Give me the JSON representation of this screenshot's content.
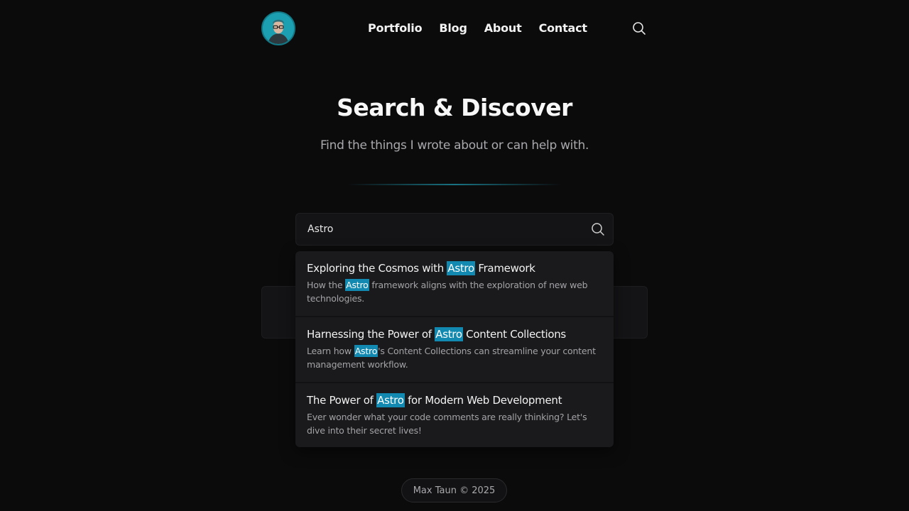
{
  "nav": {
    "avatar_icon": "avatar-portrait",
    "links": [
      "Portfolio",
      "Blog",
      "About",
      "Contact"
    ],
    "search_icon": "search-icon"
  },
  "hero": {
    "title": "Search & Discover",
    "subtitle": "Find the things I wrote about or can help with."
  },
  "search": {
    "value": "Astro",
    "placeholder": "",
    "icon": "search-icon"
  },
  "results": [
    {
      "title_before": "Exploring the Cosmos with ",
      "title_highlight": "Astro",
      "title_after": " Framework",
      "desc_before": "How the ",
      "desc_highlight": "Astro",
      "desc_after": " framework aligns with the exploration of new web technologies."
    },
    {
      "title_before": "Harnessing the Power of ",
      "title_highlight": "Astro",
      "title_after": " Content Collections",
      "desc_before": "Learn how ",
      "desc_highlight": "Astro",
      "desc_after": "'s Content Collections can streamline your content management workflow."
    },
    {
      "title_before": "The Power of ",
      "title_highlight": "Astro",
      "title_after": " for Modern Web Development",
      "desc_full": "Ever wonder what your code comments are really thinking? Let's dive into their secret lives!"
    }
  ],
  "footer": {
    "text": "Max Taun © 2025"
  },
  "colors": {
    "background": "#0b0b0c",
    "highlight": "#1289b0",
    "accent": "#1fa3b3"
  }
}
